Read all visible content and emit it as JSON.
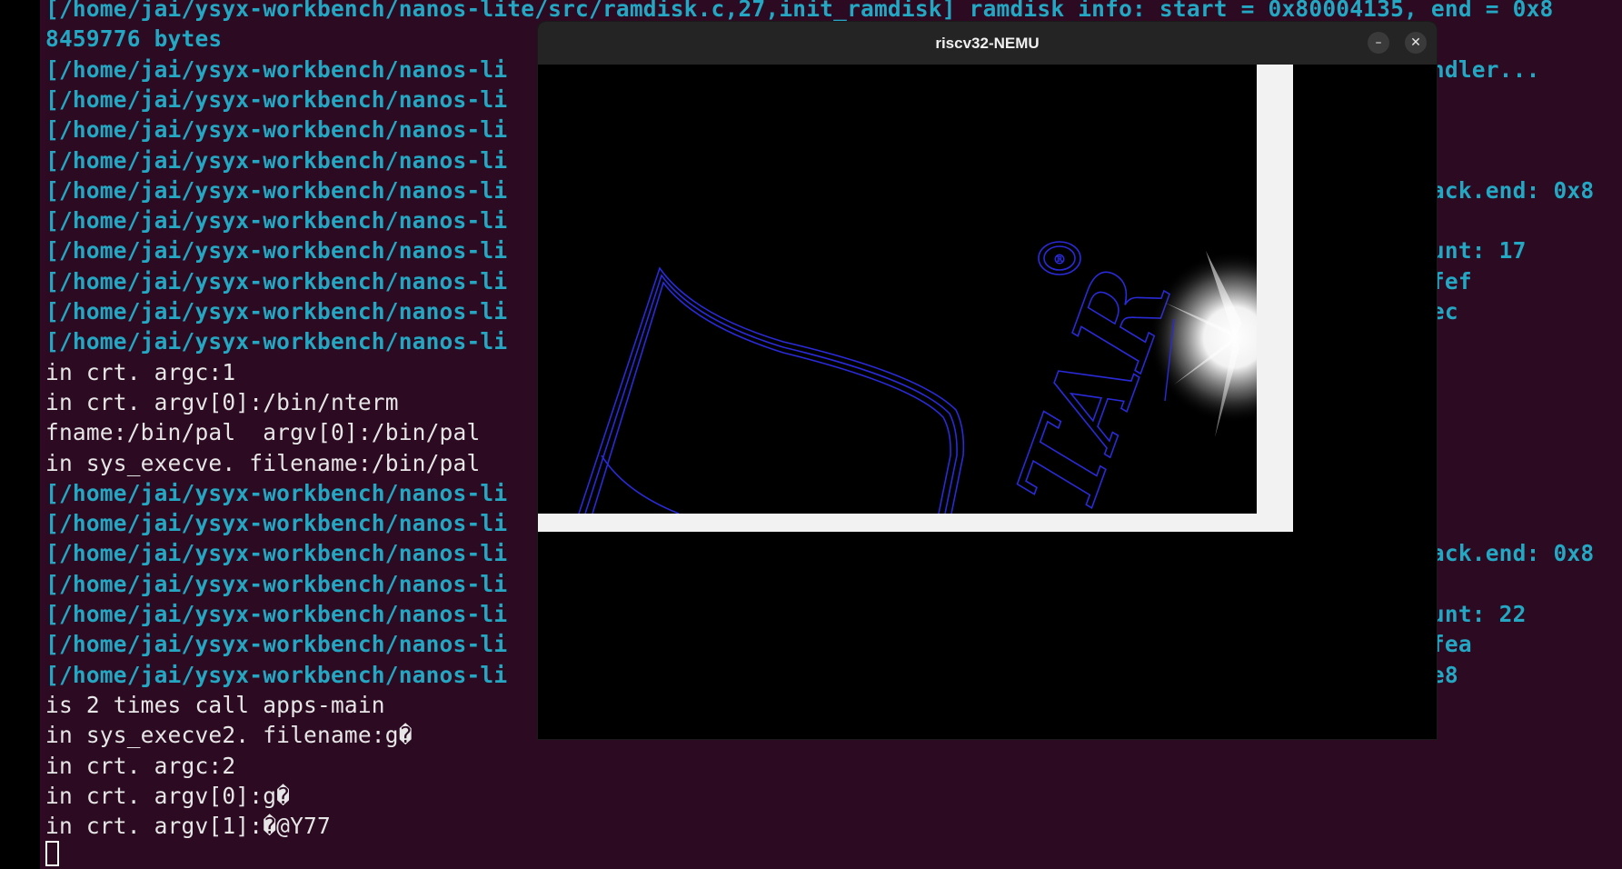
{
  "terminal": {
    "lines": [
      {
        "text": "[/home/jai/ysyx-workbench/nanos-lite/src/ramdisk.c,27,init_ramdisk] ramdisk info: start = 0x80004135, end = 0x8",
        "style": "log"
      },
      {
        "text": "8459776 bytes",
        "style": "log"
      },
      {
        "text": "[/home/jai/ysyx-workbench/nanos-li                                                                    ndler...",
        "style": "log"
      },
      {
        "text": "[/home/jai/ysyx-workbench/nanos-li",
        "style": "log"
      },
      {
        "text": "[/home/jai/ysyx-workbench/nanos-li",
        "style": "log"
      },
      {
        "text": "[/home/jai/ysyx-workbench/nanos-li",
        "style": "log"
      },
      {
        "text": "[/home/jai/ysyx-workbench/nanos-li                                                                   tack.end: 0x8",
        "style": "log"
      },
      {
        "text": "[/home/jai/ysyx-workbench/nanos-li",
        "style": "log"
      },
      {
        "text": "[/home/jai/ysyx-workbench/nanos-li                                                                   ount: 17",
        "style": "log"
      },
      {
        "text": "[/home/jai/ysyx-workbench/nanos-li                                                                   4fef",
        "style": "log"
      },
      {
        "text": "[/home/jai/ysyx-workbench/nanos-li                                                                   fec",
        "style": "log"
      },
      {
        "text": "[/home/jai/ysyx-workbench/nanos-li",
        "style": "log"
      },
      {
        "text": "in crt. argc:1",
        "style": "plain"
      },
      {
        "text": "in crt. argv[0]:/bin/nterm",
        "style": "plain"
      },
      {
        "text": "fname:/bin/pal  argv[0]:/bin/pal",
        "style": "plain"
      },
      {
        "text": "in sys_execve. filename:/bin/pal",
        "style": "plain"
      },
      {
        "text": "[/home/jai/ysyx-workbench/nanos-li",
        "style": "log"
      },
      {
        "text": "[/home/jai/ysyx-workbench/nanos-li",
        "style": "log"
      },
      {
        "text": "[/home/jai/ysyx-workbench/nanos-li                                                                   tack.end: 0x8",
        "style": "log"
      },
      {
        "text": "[/home/jai/ysyx-workbench/nanos-li",
        "style": "log"
      },
      {
        "text": "[/home/jai/ysyx-workbench/nanos-li                                                                   ount: 22",
        "style": "log"
      },
      {
        "text": "[/home/jai/ysyx-workbench/nanos-li                                                                   cfea",
        "style": "log"
      },
      {
        "text": "[/home/jai/ysyx-workbench/nanos-li                                                                   fe8",
        "style": "log"
      },
      {
        "text": "is 2 times call apps-main",
        "style": "plain"
      },
      {
        "text": "in sys_execve2. filename:g�",
        "style": "plain"
      },
      {
        "text": "in crt. argc:2",
        "style": "plain"
      },
      {
        "text": "in crt. argv[0]:g�",
        "style": "plain"
      },
      {
        "text": "in crt. argv[1]:�@Y77",
        "style": "plain"
      }
    ]
  },
  "window": {
    "title": "riscv32-NEMU",
    "minimize_label": "–",
    "close_label": "✕"
  },
  "colors": {
    "terminal_log": "#24a7c2",
    "terminal_text": "#e6e6e6",
    "terminal_bg": "#2c0a21",
    "logo_stroke": "#2a2ad8"
  },
  "game_screen": {
    "logo_text": "TAR"
  }
}
